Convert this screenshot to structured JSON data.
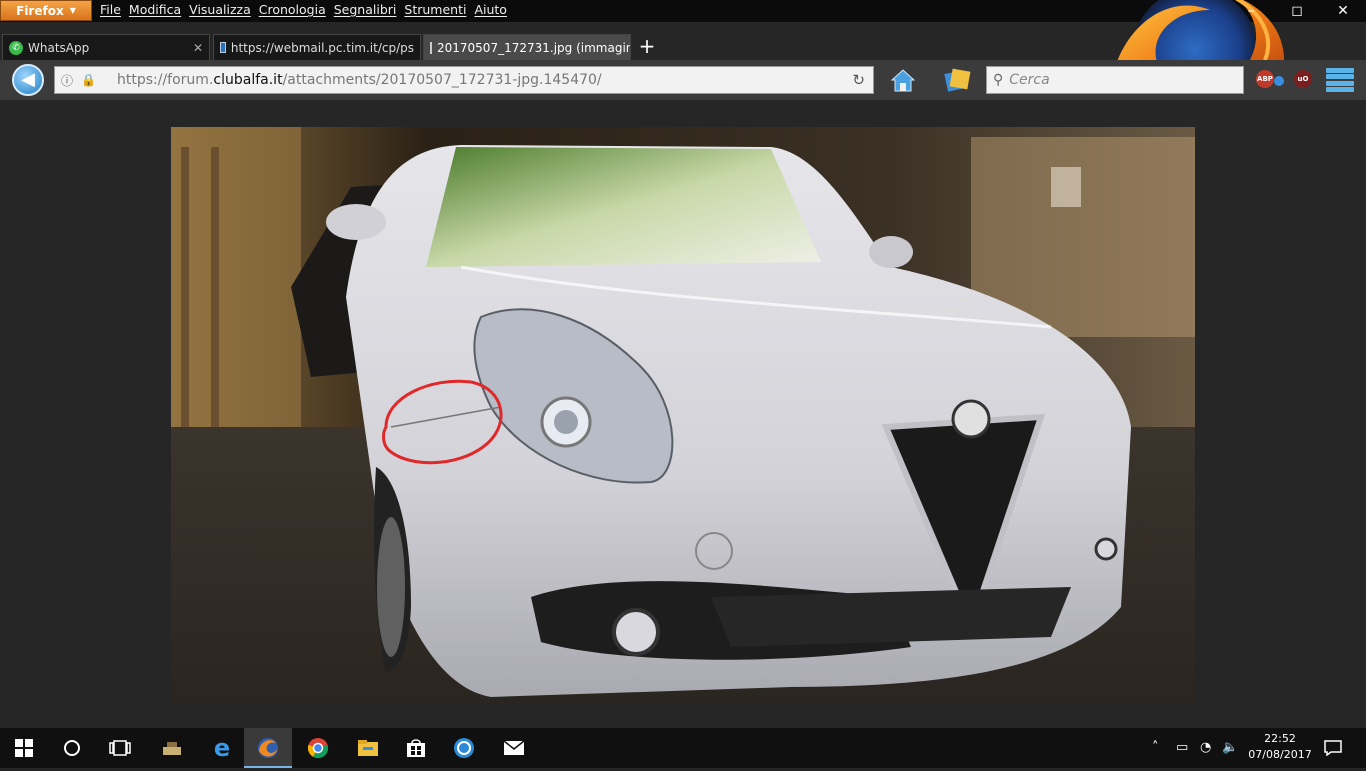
{
  "browser": {
    "menu_button": "Firefox",
    "menu_items": [
      "File",
      "Modifica",
      "Visualizza",
      "Cronologia",
      "Segnalibri",
      "Strumenti",
      "Aiuto"
    ],
    "window_controls": {
      "minimize": "–",
      "maximize": "◻",
      "close": "✕"
    }
  },
  "tabs": [
    {
      "label": "WhatsApp",
      "icon": "whatsapp-icon",
      "active": false
    },
    {
      "label": "https://webmail.pc.tim.it/cp/ps",
      "icon": "mail-icon",
      "active": false
    },
    {
      "label": "20170507_172731.jpg (immagin",
      "icon": "image-icon",
      "active": true
    }
  ],
  "new_tab_label": "+",
  "navbar": {
    "url_prefix": "https://forum.",
    "url_domain": "clubalfa.it",
    "url_suffix": "/attachments/20170507_172731-jpg.145470/",
    "search_placeholder": "Cerca",
    "extensions": [
      {
        "label": "ABP",
        "color": "#c0392b"
      },
      {
        "label": "uO",
        "color": "#7a1f1f"
      }
    ]
  },
  "image": {
    "subject": "white car front with red circle annotation",
    "annotation_color": "#e0282a"
  },
  "taskbar": {
    "time": "22:52",
    "date": "07/08/2017",
    "apps": [
      "windows-start-icon",
      "cortana-icon",
      "task-view-icon",
      "cubes-app-icon",
      "edge-icon",
      "firefox-icon",
      "chrome-icon",
      "file-explorer-icon",
      "store-icon",
      "shield-app-icon",
      "mail-app-icon"
    ]
  }
}
